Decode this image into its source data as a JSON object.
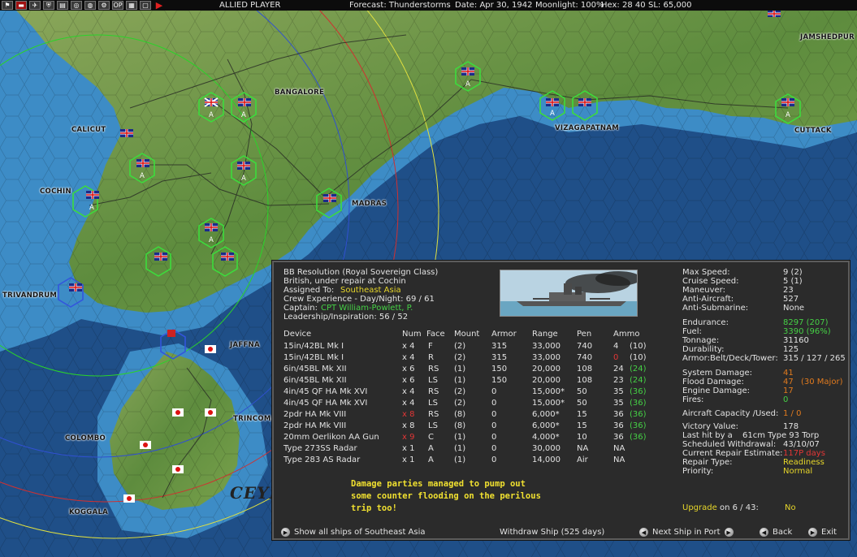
{
  "topbar": {
    "player": "ALLIED PLAYER",
    "forecast": "Forecast: Thunderstorms",
    "date": "Date: Apr 30, 1942",
    "moonlight": "Moonlight: 100%",
    "hex": "Hex: 28  40",
    "sl": "SL: 65,000",
    "icons": [
      "flag-icon",
      "ship-icon",
      "aircraft-icon",
      "ground-unit-icon",
      "document-icon",
      "target-icon",
      "globe-icon",
      "settings-icon",
      "op-icon",
      "report-icon",
      "window-icon",
      "play-icon"
    ]
  },
  "map": {
    "cities": {
      "jamshedpur": "JAMSHEDPUR",
      "bangalore": "BANGALORE",
      "calicut": "CALICUT",
      "cochin": "COCHIN",
      "madras": "MADRAS",
      "vizagapatnam": "VIZAGAPATNAM",
      "cuttack": "CUTTACK",
      "trivandrum": "TRIVANDRUM",
      "jaffna": "JAFFNA",
      "trincomalee": "TRINCOMA",
      "colombo": "COLOMBO",
      "koggala": "KOGGALA"
    },
    "ceylon_label": "CEYL",
    "unit_marker": "A",
    "colors": {
      "sea": "#1f4f88",
      "shallow": "#4fa8d8",
      "land": "#6f9b4a",
      "allied_hex": "#3cdc3c",
      "japanese_hex": "#3355cc"
    }
  },
  "ship": {
    "name": "BB Resolution (Royal Sovereign Class)",
    "status": "British, under repair at Cochin",
    "assigned_label": "Assigned To:",
    "assigned_value": "Southeast Asia",
    "crew_exp": "Crew Experience - Day/Night:  69 / 61",
    "captain_label": "Captain:",
    "captain_value": "CPT William-Powlett, P.",
    "leadership": "Leadership/Inspiration: 56 / 52"
  },
  "table": {
    "headers": [
      "Device",
      "Num",
      "Face",
      "Mount",
      "Armor",
      "Range",
      "Pen",
      "Ammo"
    ],
    "rows": [
      {
        "device": "15in/42BL Mk I",
        "num": "x 4",
        "face": "F",
        "mount": "(2)",
        "armor": "315",
        "range": "33,000",
        "pen": "740",
        "ammo": "4",
        "ammo_max": "(10)"
      },
      {
        "device": "15in/42BL Mk I",
        "num": "x 4",
        "face": "R",
        "mount": "(2)",
        "armor": "315",
        "range": "33,000",
        "pen": "740",
        "ammo": "0",
        "ammo_max": "(10)"
      },
      {
        "device": "6in/45BL Mk XII",
        "num": "x 6",
        "face": "RS",
        "mount": "(1)",
        "armor": "150",
        "range": "20,000",
        "pen": "108",
        "ammo": "24",
        "ammo_max": "(24)"
      },
      {
        "device": "6in/45BL Mk XII",
        "num": "x 6",
        "face": "LS",
        "mount": "(1)",
        "armor": "150",
        "range": "20,000",
        "pen": "108",
        "ammo": "23",
        "ammo_max": "(24)"
      },
      {
        "device": "4in/45 QF HA Mk XVI",
        "num": "x 4",
        "face": "RS",
        "mount": "(2)",
        "armor": "0",
        "range": "15,000*",
        "pen": "50",
        "ammo": "35",
        "ammo_max": "(36)"
      },
      {
        "device": "4in/45 QF HA Mk XVI",
        "num": "x 4",
        "face": "LS",
        "mount": "(2)",
        "armor": "0",
        "range": "15,000*",
        "pen": "50",
        "ammo": "35",
        "ammo_max": "(36)"
      },
      {
        "device": "2pdr HA Mk VIII",
        "num": "x 8",
        "face": "RS",
        "mount": "(8)",
        "armor": "0",
        "range": "6,000*",
        "pen": "15",
        "ammo": "36",
        "ammo_max": "(36)"
      },
      {
        "device": "2pdr HA Mk VIII",
        "num": "x 8",
        "face": "LS",
        "mount": "(8)",
        "armor": "0",
        "range": "6,000*",
        "pen": "15",
        "ammo": "36",
        "ammo_max": "(36)"
      },
      {
        "device": "20mm Oerlikon AA Gun",
        "num": "x 9",
        "face": "C",
        "mount": "(1)",
        "armor": "0",
        "range": "4,000*",
        "pen": "10",
        "ammo": "36",
        "ammo_max": "(36)"
      },
      {
        "device": "Type 273SS Radar",
        "num": "x 1",
        "face": "A",
        "mount": "(1)",
        "armor": "0",
        "range": "30,000",
        "pen": "NA",
        "ammo": "NA",
        "ammo_max": ""
      },
      {
        "device": "Type 283 AS Radar",
        "num": "x 1",
        "face": "A",
        "mount": "(1)",
        "armor": "0",
        "range": "14,000",
        "pen": "Air",
        "ammo": "NA",
        "ammo_max": ""
      }
    ]
  },
  "message": "Damage parties managed to pump  out some counter flooding on the perilous trip too!",
  "stats": {
    "max_speed": [
      "Max Speed:",
      "9  (2)"
    ],
    "cruise_speed": [
      "Cruise Speed:",
      "5  (1)"
    ],
    "maneuver": [
      "Maneuver:",
      "23"
    ],
    "anti_aircraft": [
      "Anti-Aircraft:",
      "527"
    ],
    "anti_sub": [
      "Anti-Submarine:",
      "None"
    ],
    "endurance": [
      "Endurance:",
      "8297 (207)"
    ],
    "fuel": [
      "Fuel:",
      "3390 (96%)"
    ],
    "tonnage": [
      "Tonnage:",
      "31160"
    ],
    "durability": [
      "Durability:",
      "125"
    ],
    "armor": [
      "Armor:Belt/Deck/Tower:",
      "315 / 127 / 265"
    ],
    "system_damage": [
      "System Damage:",
      "41"
    ],
    "flood_damage": [
      "Flood Damage:",
      "47",
      "(30 Major)"
    ],
    "engine_damage": [
      "Engine Damage:",
      "17"
    ],
    "fires": [
      "Fires:",
      "0"
    ],
    "aircraft_capacity": [
      "Aircraft Capacity /Used:",
      "1 / 0"
    ],
    "victory_value": [
      "Victory Value:",
      "178"
    ],
    "last_hit": [
      "Last hit by a",
      "61cm Type 93 Torp"
    ],
    "scheduled_withdrawal": [
      "Scheduled Withdrawal:",
      "43/10/07"
    ],
    "repair_estimate": [
      "Current Repair Estimate:",
      "117P days"
    ],
    "repair_type": [
      "Repair Type:",
      "Readiness"
    ],
    "priority": [
      "Priority:",
      "Normal"
    ],
    "upgrade_label": "Upgrade",
    "upgrade_on": "on  6 / 43:",
    "upgrade_value": "No"
  },
  "buttons": {
    "show_all": "Show all ships of Southeast Asia",
    "withdraw": "Withdraw Ship (525 days)",
    "next_ship": "Next Ship in Port",
    "back": "Back",
    "exit": "Exit"
  }
}
